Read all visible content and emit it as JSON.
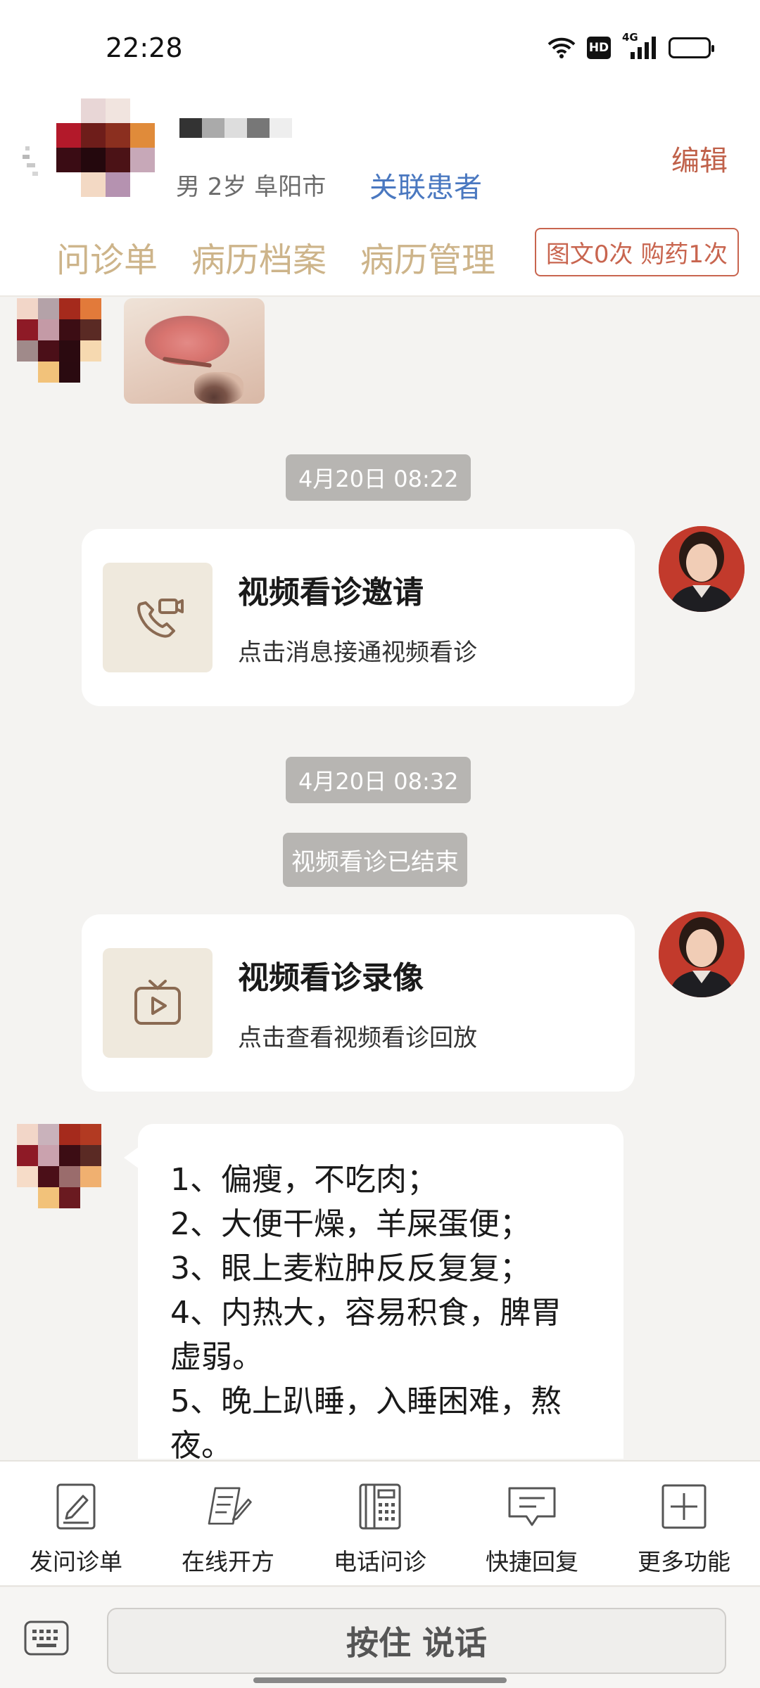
{
  "status_bar": {
    "time": "22:28",
    "hd_label": "HD",
    "network_label": "4G",
    "icons": [
      "wifi-icon",
      "hd-icon",
      "signal-4g-icon",
      "battery-icon"
    ]
  },
  "header": {
    "patient_meta": "男 2岁  阜阳市",
    "link_patient": "关联患者",
    "edit": "编辑",
    "tabs": [
      "问诊单",
      "病历档案",
      "病历管理"
    ],
    "quota": "图文0次 购药1次"
  },
  "chat": {
    "time_1": "4月20日 08:22",
    "card_1": {
      "title": "视频看诊邀请",
      "subtitle": "点击消息接通视频看诊",
      "icon": "video-call-icon"
    },
    "time_2": "4月20日 08:32",
    "system_notice": "视频看诊已结束",
    "card_2": {
      "title": "视频看诊录像",
      "subtitle": "点击查看视频看诊回放",
      "icon": "video-playback-icon"
    },
    "message_lines": [
      "1、偏瘦，不吃肉；",
      "2、大便干燥，羊屎蛋便；",
      "3、眼上麦粒肿反反复复；",
      "4、内热大，容易积食，脾胃",
      "虚弱。",
      "5、晚上趴睡，入睡困难，熬",
      "夜。"
    ]
  },
  "toolbar": {
    "items": [
      {
        "label": "发问诊单",
        "icon": "form-edit-icon"
      },
      {
        "label": "在线开方",
        "icon": "prescription-icon"
      },
      {
        "label": "电话问诊",
        "icon": "phone-consult-icon"
      },
      {
        "label": "快捷回复",
        "icon": "quick-reply-icon"
      },
      {
        "label": "更多功能",
        "icon": "more-functions-icon"
      }
    ]
  },
  "input": {
    "keyboard_icon": "keyboard-icon",
    "hold_to_talk": "按住 说话"
  },
  "colors": {
    "accent_tab": "#cdb48a",
    "edit": "#c0614a",
    "link": "#4a78c0",
    "quota_border": "#c8654f",
    "chat_bg": "#f4f3f1"
  }
}
